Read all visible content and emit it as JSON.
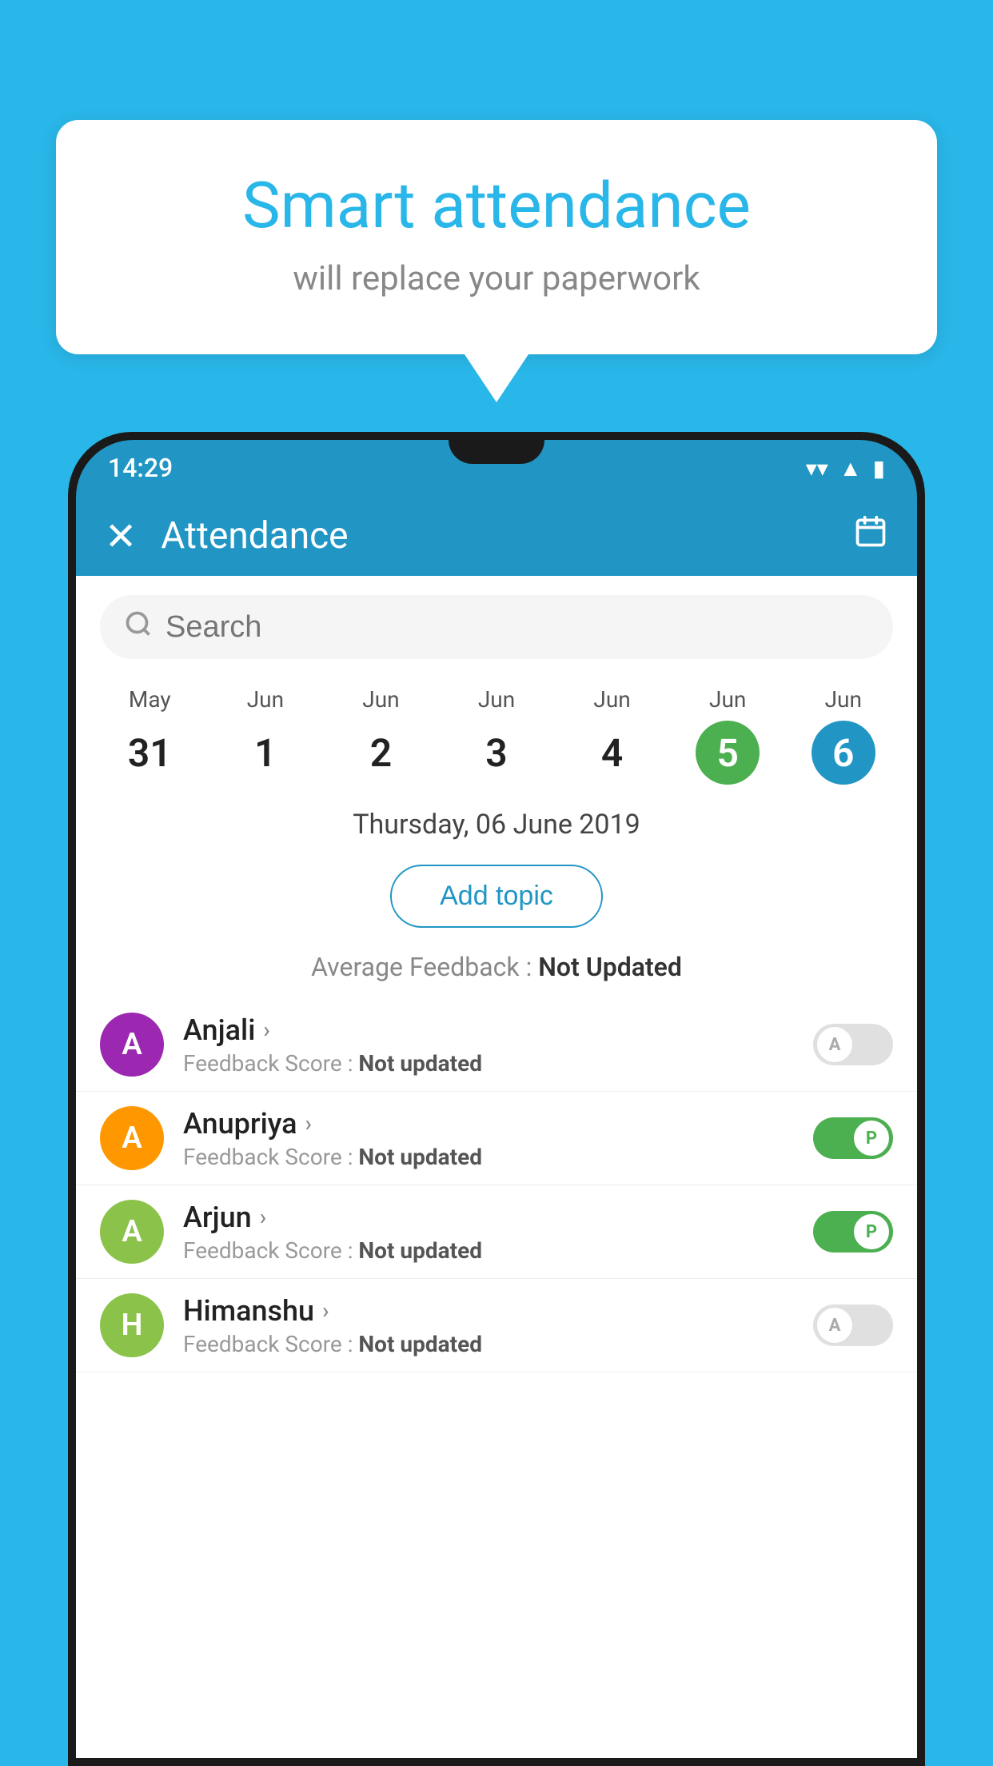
{
  "background_color": "#29b6e8",
  "bubble": {
    "title": "Smart attendance",
    "subtitle": "will replace your paperwork"
  },
  "status_bar": {
    "time": "14:29",
    "icons": [
      "▼",
      "◀",
      "▮"
    ]
  },
  "app_bar": {
    "title": "Attendance",
    "close_icon": "✕",
    "calendar_icon": "📅"
  },
  "search": {
    "placeholder": "Search"
  },
  "dates": [
    {
      "month": "May",
      "day": "31",
      "highlight": "none"
    },
    {
      "month": "Jun",
      "day": "1",
      "highlight": "none"
    },
    {
      "month": "Jun",
      "day": "2",
      "highlight": "none"
    },
    {
      "month": "Jun",
      "day": "3",
      "highlight": "none"
    },
    {
      "month": "Jun",
      "day": "4",
      "highlight": "none"
    },
    {
      "month": "Jun",
      "day": "5",
      "highlight": "today"
    },
    {
      "month": "Jun",
      "day": "6",
      "highlight": "selected"
    }
  ],
  "selected_date_label": "Thursday, 06 June 2019",
  "add_topic_label": "Add topic",
  "avg_feedback_label": "Average Feedback : ",
  "avg_feedback_value": "Not Updated",
  "students": [
    {
      "name": "Anjali",
      "avatar_letter": "A",
      "avatar_color": "#9c27b0",
      "feedback_label": "Feedback Score : ",
      "feedback_value": "Not updated",
      "status": "absent",
      "toggle_label": "A"
    },
    {
      "name": "Anupriya",
      "avatar_letter": "A",
      "avatar_color": "#ff9800",
      "feedback_label": "Feedback Score : ",
      "feedback_value": "Not updated",
      "status": "present",
      "toggle_label": "P"
    },
    {
      "name": "Arjun",
      "avatar_letter": "A",
      "avatar_color": "#8bc34a",
      "feedback_label": "Feedback Score : ",
      "feedback_value": "Not updated",
      "status": "present",
      "toggle_label": "P"
    },
    {
      "name": "Himanshu",
      "avatar_letter": "H",
      "avatar_color": "#8bc34a",
      "feedback_label": "Feedback Score : ",
      "feedback_value": "Not updated",
      "status": "absent",
      "toggle_label": "A"
    }
  ]
}
